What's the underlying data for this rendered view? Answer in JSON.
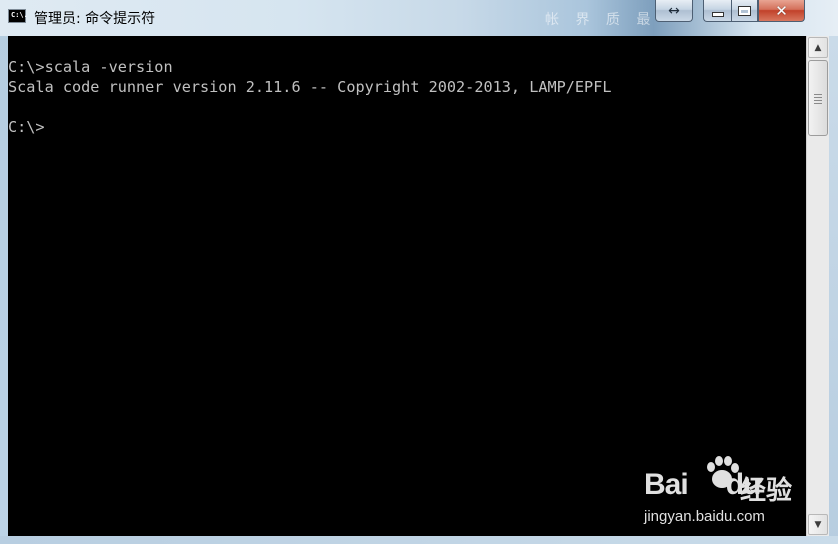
{
  "window": {
    "title": "管理员: 命令提示符",
    "icon_label": "C:\\.",
    "background_ghost_text": "帐 界 质 最",
    "controls": {
      "resize": "↔",
      "minimize": "minimize",
      "maximize": "maximize",
      "close": "✕"
    }
  },
  "console": {
    "lines": [
      "C:\\>scala -version",
      "Scala code runner version 2.11.6 -- Copyright 2002-2013, LAMP/EPFL",
      "",
      "C:\\>"
    ]
  },
  "scrollbar": {
    "up_arrow": "▲",
    "down_arrow": "▼"
  },
  "watermark": {
    "logo": "Bai",
    "logo_suffix": "du",
    "brand": "经验",
    "url": "jingyan.baidu.com"
  }
}
